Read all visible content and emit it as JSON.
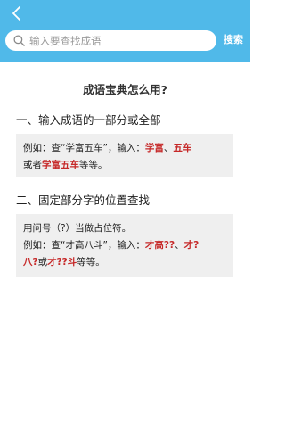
{
  "header": {
    "back_icon": "chevron-left-icon",
    "search_placeholder": "输入要查找成语",
    "search_button": "搜索",
    "accent": "#50b9e9"
  },
  "title": "成语宝典怎么用?",
  "section1": {
    "heading": "一、输入成语的一部分或全部",
    "line1_prefix": "例如：查“学富五车”，输入：",
    "hl1": "学富",
    "sep1": "、",
    "hl2": "五车",
    "line2_prefix": "或者",
    "hl3": "学富五车",
    "line2_suffix": "等等。"
  },
  "section2": {
    "heading": "二、固定部分字的位置查找",
    "line1": "用问号（?）当做占位符。",
    "line2_prefix": "例如：查“才高八斗”，输入：",
    "hl1": "才高??",
    "sep1": "、",
    "hl2a": "才?",
    "hl2b": "八?",
    "or": "或",
    "hl3": "才??斗",
    "suffix": "等等。"
  },
  "colors": {
    "highlight": "#c62828",
    "box_bg": "#efefef"
  }
}
